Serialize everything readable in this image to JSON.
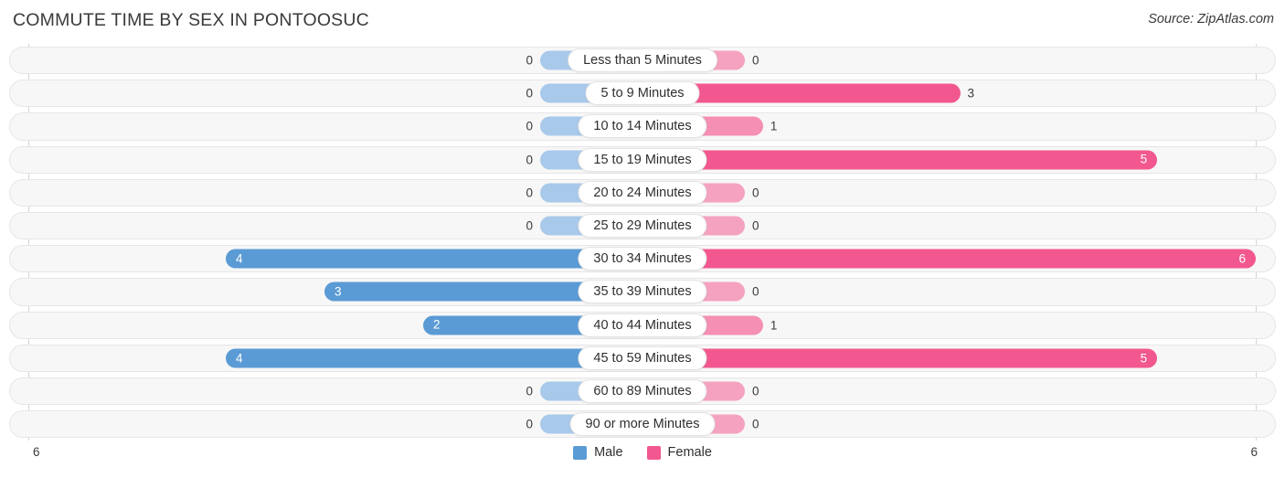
{
  "header": {
    "title": "COMMUTE TIME BY SEX IN PONTOOSUC",
    "source": "Source: ZipAtlas.com"
  },
  "legend": {
    "male_label": "Male",
    "female_label": "Female",
    "male_color": "#5b9bd5",
    "female_color": "#f2588f"
  },
  "axis": {
    "left_end_label": "6",
    "right_end_label": "6",
    "max": 6
  },
  "chart_data": {
    "type": "bar",
    "orientation": "horizontal-diverging",
    "title": "COMMUTE TIME BY SEX IN PONTOOSUC",
    "xlabel": "",
    "ylabel": "",
    "xlim": [
      6,
      6
    ],
    "grid": false,
    "legend_position": "bottom-center",
    "categories": [
      "Less than 5 Minutes",
      "5 to 9 Minutes",
      "10 to 14 Minutes",
      "15 to 19 Minutes",
      "20 to 24 Minutes",
      "25 to 29 Minutes",
      "30 to 34 Minutes",
      "35 to 39 Minutes",
      "40 to 44 Minutes",
      "45 to 59 Minutes",
      "60 to 89 Minutes",
      "90 or more Minutes"
    ],
    "series": [
      {
        "name": "Male",
        "values": [
          0,
          0,
          0,
          0,
          0,
          0,
          4,
          3,
          2,
          4,
          0,
          0
        ]
      },
      {
        "name": "Female",
        "values": [
          0,
          3,
          1,
          5,
          0,
          0,
          6,
          0,
          1,
          5,
          0,
          0
        ]
      }
    ]
  },
  "rows": [
    {
      "category": "Less than 5 Minutes",
      "male": "0",
      "female": "0"
    },
    {
      "category": "5 to 9 Minutes",
      "male": "0",
      "female": "3"
    },
    {
      "category": "10 to 14 Minutes",
      "male": "0",
      "female": "1"
    },
    {
      "category": "15 to 19 Minutes",
      "male": "0",
      "female": "5"
    },
    {
      "category": "20 to 24 Minutes",
      "male": "0",
      "female": "0"
    },
    {
      "category": "25 to 29 Minutes",
      "male": "0",
      "female": "0"
    },
    {
      "category": "30 to 34 Minutes",
      "male": "4",
      "female": "6"
    },
    {
      "category": "35 to 39 Minutes",
      "male": "3",
      "female": "0"
    },
    {
      "category": "40 to 44 Minutes",
      "male": "2",
      "female": "1"
    },
    {
      "category": "45 to 59 Minutes",
      "male": "4",
      "female": "5"
    },
    {
      "category": "60 to 89 Minutes",
      "male": "0",
      "female": "0"
    },
    {
      "category": "90 or more Minutes",
      "male": "0",
      "female": "0"
    }
  ]
}
